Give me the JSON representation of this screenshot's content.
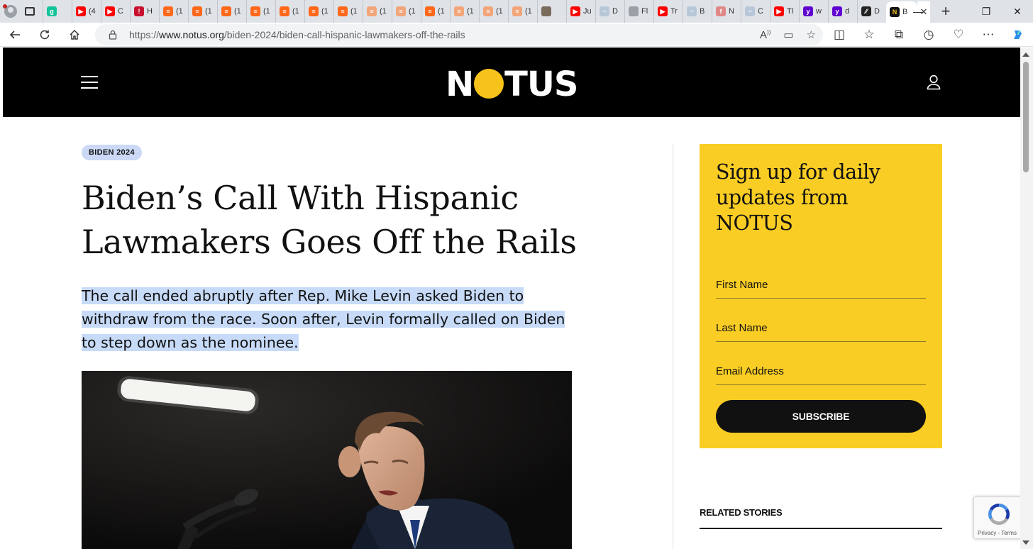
{
  "browser": {
    "tabs": [
      {
        "label": "",
        "fav": "grammarly",
        "color": "#15c39a",
        "glyph": "g"
      },
      {
        "label": "(4",
        "fav": "youtube",
        "color": "#ff0000",
        "glyph": "▶"
      },
      {
        "label": "C",
        "fav": "youtube",
        "color": "#ff0000",
        "glyph": "▶"
      },
      {
        "label": "H",
        "fav": "news",
        "color": "#c8102e",
        "glyph": "!"
      },
      {
        "label": "(1",
        "fav": "substack",
        "color": "#ff6719",
        "glyph": "≡"
      },
      {
        "label": "(1",
        "fav": "substack",
        "color": "#ff6719",
        "glyph": "≡"
      },
      {
        "label": "(1",
        "fav": "substack",
        "color": "#ff6719",
        "glyph": "≡"
      },
      {
        "label": "(1",
        "fav": "substack",
        "color": "#ff6719",
        "glyph": "≡"
      },
      {
        "label": "(1",
        "fav": "substack",
        "color": "#ff6719",
        "glyph": "≡"
      },
      {
        "label": "(1",
        "fav": "substack",
        "color": "#ff6719",
        "glyph": "≡"
      },
      {
        "label": "(1",
        "fav": "substack",
        "color": "#ff6719",
        "glyph": "≡"
      },
      {
        "label": "(1",
        "fav": "substack",
        "color": "#f3a57a",
        "glyph": "≡"
      },
      {
        "label": "(1",
        "fav": "substack",
        "color": "#f3a57a",
        "glyph": "≡"
      },
      {
        "label": "(1",
        "fav": "substack",
        "color": "#ff6719",
        "glyph": "≡"
      },
      {
        "label": "(1",
        "fav": "substack",
        "color": "#f3a57a",
        "glyph": "≡"
      },
      {
        "label": "(1",
        "fav": "substack",
        "color": "#f3a57a",
        "glyph": "≡"
      },
      {
        "label": "(1",
        "fav": "substack",
        "color": "#f3a57a",
        "glyph": "≡"
      },
      {
        "label": "",
        "fav": "photo",
        "color": "#7a6b5d",
        "glyph": ""
      },
      {
        "label": "Ju",
        "fav": "youtube",
        "color": "#ff0000",
        "glyph": "▶"
      },
      {
        "label": "D",
        "fav": "loading",
        "color": "#b8c7d8",
        "glyph": "~"
      },
      {
        "label": "Fl",
        "fav": "document",
        "color": "#9aa0a6",
        "glyph": ""
      },
      {
        "label": "Tr",
        "fav": "youtube",
        "color": "#ff0000",
        "glyph": "▶"
      },
      {
        "label": "B",
        "fav": "loading",
        "color": "#b8c7d8",
        "glyph": "~"
      },
      {
        "label": "N",
        "fav": "letter",
        "color": "#e08787",
        "glyph": "f"
      },
      {
        "label": "C",
        "fav": "loading",
        "color": "#b8c7d8",
        "glyph": "~"
      },
      {
        "label": "Tl",
        "fav": "youtube",
        "color": "#ff0000",
        "glyph": "▶"
      },
      {
        "label": "w",
        "fav": "yahoo",
        "color": "#6001d2",
        "glyph": "y"
      },
      {
        "label": "d",
        "fav": "yahoo",
        "color": "#6001d2",
        "glyph": "y"
      },
      {
        "label": "D",
        "fav": "app",
        "color": "#222222",
        "glyph": "⁄⁄"
      }
    ],
    "active_tab_label": "B",
    "url_prefix": "https://",
    "url_domain": "www.notus.org",
    "url_path": "/biden-2024/biden-call-hispanic-lawmakers-off-the-rails"
  },
  "site": {
    "logo_before": "N",
    "logo_after": "TUS",
    "brand_color": "#f7c21a"
  },
  "article": {
    "badge": "BIDEN 2024",
    "headline": "Biden’s Call With Hispanic Lawmakers Goes Off the Rails",
    "dek": "The call ended abruptly after Rep. Mike Levin asked Biden to withdraw from the race. Soon after, Levin formally called on Biden to step down as the nominee."
  },
  "signup": {
    "title": "Sign up for daily updates from NOTUS",
    "first_name": "First Name",
    "last_name": "Last Name",
    "email": "Email Address",
    "button": "SUBSCRIBE"
  },
  "sidebar": {
    "related_title": "RELATED STORIES"
  },
  "recaptcha": {
    "links": "Privacy - Terms"
  }
}
